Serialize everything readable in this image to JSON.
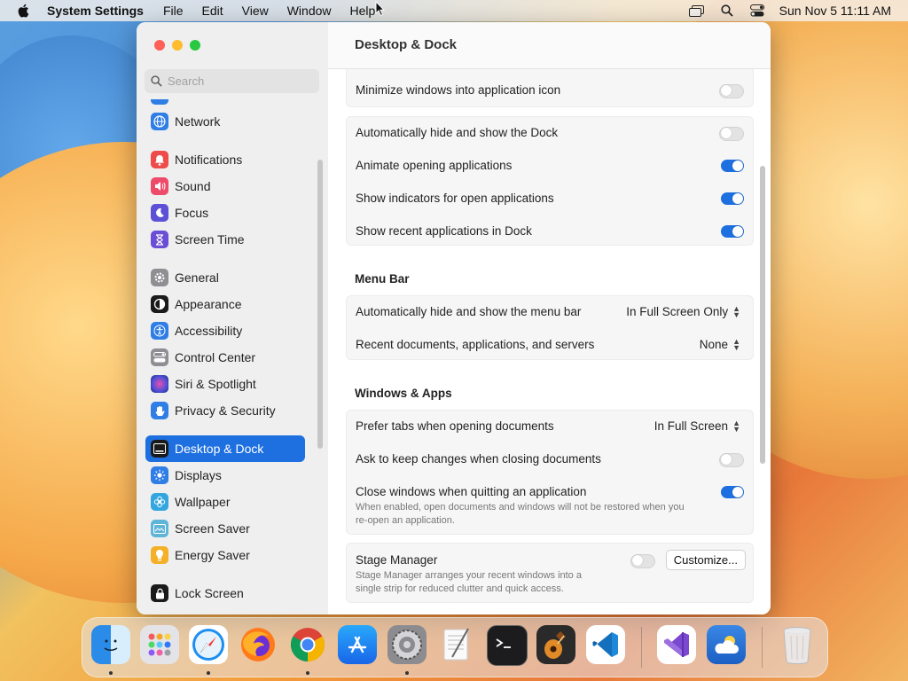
{
  "menubar": {
    "app_name": "System Settings",
    "menus": [
      "File",
      "Edit",
      "View",
      "Window",
      "Help"
    ],
    "clock": "Sun Nov 5  11:11 AM"
  },
  "window": {
    "title": "Desktop & Dock",
    "search_placeholder": "Search"
  },
  "sidebar": {
    "items": [
      {
        "label": "Network",
        "icon": "globe-icon",
        "color": "#2f7ee6"
      },
      {
        "label": "Notifications",
        "icon": "bell-icon",
        "color": "#ee4b4b"
      },
      {
        "label": "Sound",
        "icon": "speaker-icon",
        "color": "#ee4b6a"
      },
      {
        "label": "Focus",
        "icon": "moon-icon",
        "color": "#5b50d6"
      },
      {
        "label": "Screen Time",
        "icon": "hourglass-icon",
        "color": "#6a4fd6"
      },
      {
        "label": "General",
        "icon": "gear-icon",
        "color": "#8e8e93"
      },
      {
        "label": "Appearance",
        "icon": "appearance-icon",
        "color": "#1a1a1a"
      },
      {
        "label": "Accessibility",
        "icon": "accessibility-icon",
        "color": "#2f7ee6"
      },
      {
        "label": "Control Center",
        "icon": "control-center-icon",
        "color": "#8e8e93"
      },
      {
        "label": "Siri & Spotlight",
        "icon": "siri-icon",
        "color": "#3b3b6e"
      },
      {
        "label": "Privacy & Security",
        "icon": "hand-icon",
        "color": "#2f7ee6"
      },
      {
        "label": "Desktop & Dock",
        "icon": "dock-icon",
        "color": "#1a1a1a"
      },
      {
        "label": "Displays",
        "icon": "sun-icon",
        "color": "#2f7ee6"
      },
      {
        "label": "Wallpaper",
        "icon": "flower-icon",
        "color": "#33a6e0"
      },
      {
        "label": "Screen Saver",
        "icon": "screensaver-icon",
        "color": "#5fb5d8"
      },
      {
        "label": "Energy Saver",
        "icon": "battery-icon",
        "color": "#f5b02a"
      },
      {
        "label": "Lock Screen",
        "icon": "lock-icon",
        "color": "#1a1a1a"
      }
    ],
    "selected": "Desktop & Dock"
  },
  "settings": {
    "minimize_into_icon": {
      "label": "Minimize windows into application icon",
      "value": false
    },
    "dock_autohide": {
      "label": "Automatically hide and show the Dock",
      "value": false
    },
    "animate_opening": {
      "label": "Animate opening applications",
      "value": true
    },
    "show_indicators": {
      "label": "Show indicators for open applications",
      "value": true
    },
    "show_recent": {
      "label": "Show recent applications in Dock",
      "value": true
    },
    "menu_bar_header": "Menu Bar",
    "menubar_autohide": {
      "label": "Automatically hide and show the menu bar",
      "value": "In Full Screen Only"
    },
    "recent_documents": {
      "label": "Recent documents, applications, and servers",
      "value": "None"
    },
    "windows_apps_header": "Windows & Apps",
    "prefer_tabs": {
      "label": "Prefer tabs when opening documents",
      "value": "In Full Screen"
    },
    "ask_keep_changes": {
      "label": "Ask to keep changes when closing documents",
      "value": false
    },
    "close_windows": {
      "label": "Close windows when quitting an application",
      "value": true,
      "description_line1": "When enabled, open documents and windows will not be restored when you",
      "description_line2": "re-open an application."
    },
    "stage_manager": {
      "label": "Stage Manager",
      "value": false,
      "description_line1": "Stage Manager arranges your recent windows into a",
      "description_line2": "single strip for reduced clutter and quick access.",
      "customize_label": "Customize..."
    }
  },
  "dock": {
    "apps": [
      "Finder",
      "Launchpad",
      "Safari",
      "Firefox",
      "Chrome",
      "App Store",
      "System Settings",
      "TextEdit",
      "Terminal",
      "GarageBand",
      "Visual Studio Code",
      "Visual Studio",
      "Weather",
      "Trash"
    ]
  }
}
